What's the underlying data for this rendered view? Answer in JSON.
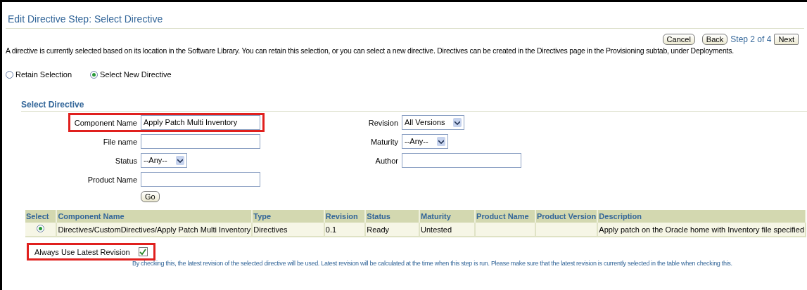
{
  "title": "Edit Directive Step: Select Directive",
  "nav": {
    "cancel": "Cancel",
    "back": "Back",
    "step": "Step 2 of 4",
    "next": "Next"
  },
  "intro": "A directive is currently selected based on its location in the Software Library. You can retain this selection, or you can select a new directive. Directives can be created in the Directives page in the Provisioning subtab, under Deployments.",
  "choices": [
    {
      "label": "Retain Selection",
      "selected": false
    },
    {
      "label": "Select New Directive",
      "selected": true
    }
  ],
  "section_title": "Select Directive",
  "left_fields": [
    {
      "label": "Component Name",
      "kind": "text",
      "value": "Apply Patch Multi Inventory",
      "highlighted": true
    },
    {
      "label": "File name",
      "kind": "text",
      "highlighted": false
    },
    {
      "label": "Status",
      "kind": "select",
      "value": "--Any--",
      "highlighted": false
    },
    {
      "label": "Product Name",
      "kind": "text",
      "highlighted": false
    }
  ],
  "right_fields": [
    {
      "label": "Revision",
      "kind": "select",
      "value": "All Versions",
      "highlighted": false
    },
    {
      "label": "Maturity",
      "kind": "select",
      "value": "--Any--",
      "highlighted": false
    },
    {
      "label": "Author",
      "kind": "text",
      "highlighted": false
    }
  ],
  "go": "Go",
  "table": {
    "columns": [
      "Select",
      "Component Name",
      "Type",
      "Revision",
      "Status",
      "Maturity",
      "Product Name",
      "Product Version",
      "Description"
    ],
    "rows": [
      {
        "selected": true,
        "cells": [
          "",
          "Directives/CustomDirectives/Apply Patch Multi Inventory",
          "Directives",
          "0.1",
          "Ready",
          "Untested",
          "",
          "",
          "Apply patch on the Oracle home with Inventory file specified"
        ]
      }
    ]
  },
  "latest": {
    "label": "Always Use Latest Revision",
    "checked": true,
    "highlighted": true
  },
  "hint": "By checking this, the latest revision of the selected directive will be used. Latest revision will be calculated at the time when this step is run. Please make sure that the latest revision is currently selected in the table when checking this."
}
